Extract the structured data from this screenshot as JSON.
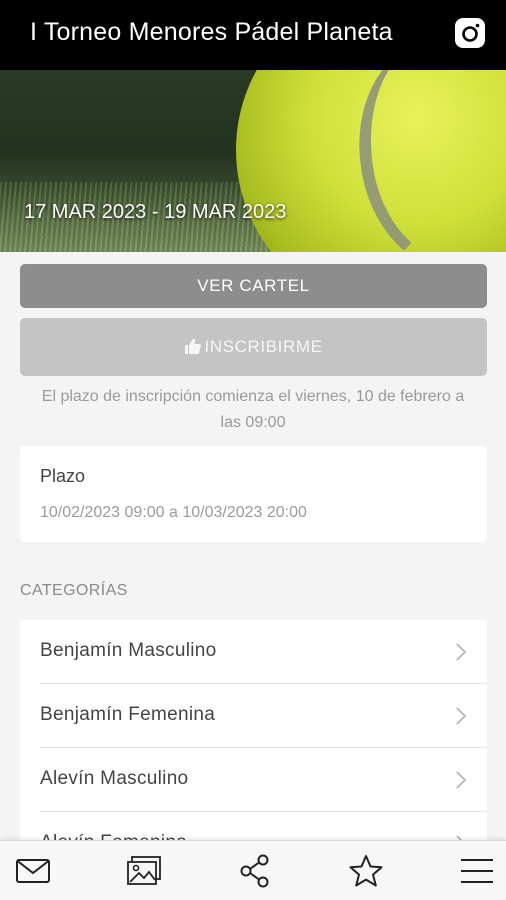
{
  "header": {
    "title": "I Torneo Menores Pádel Planeta",
    "instagram_icon": "instagram-icon"
  },
  "hero": {
    "dates": "17 MAR 2023 - 19 MAR 2023"
  },
  "actions": {
    "ver_cartel_label": "VER CARTEL",
    "inscribirme_label": "INSCRIBIRME",
    "inscribirme_icon": "thumbs-up-icon"
  },
  "notice": "El plazo de inscripción comienza el viernes, 10 de febrero a las 09:00",
  "plazo": {
    "label": "Plazo",
    "value": "10/02/2023 09:00 a 10/03/2023 20:00"
  },
  "categories": {
    "title": "CATEGORÍAS",
    "items": [
      {
        "label": "Benjamín Masculino"
      },
      {
        "label": "Benjamín Femenina"
      },
      {
        "label": "Alevín Masculino"
      },
      {
        "label": "Alevín Femenina"
      }
    ]
  },
  "bottom_nav": [
    {
      "icon": "mail-icon"
    },
    {
      "icon": "gallery-icon"
    },
    {
      "icon": "share-icon"
    },
    {
      "icon": "star-icon"
    },
    {
      "icon": "menu-icon"
    }
  ],
  "colors": {
    "topbar": "#000000",
    "primary_button": "#8d8d8d",
    "disabled_button": "#c4c4c4",
    "background": "#f4f4f4"
  }
}
